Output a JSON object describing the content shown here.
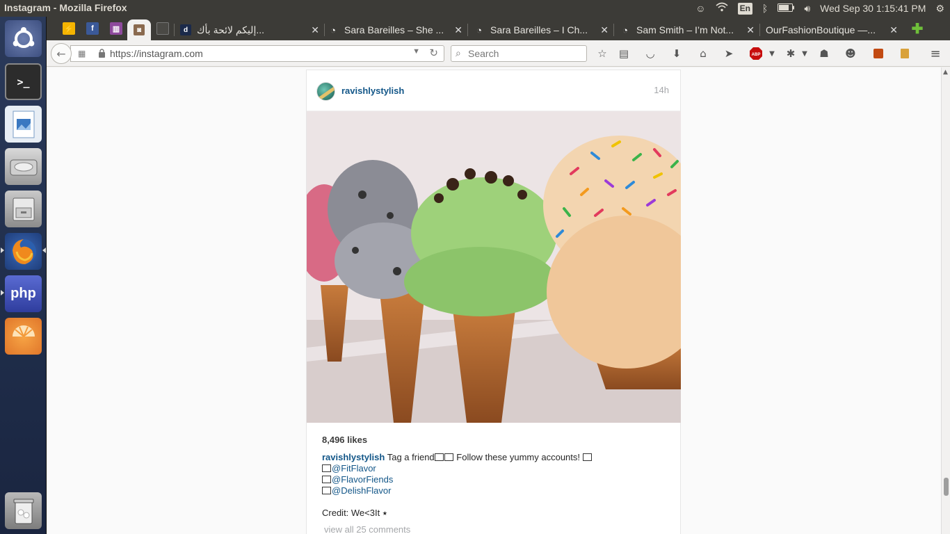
{
  "system": {
    "window_title": "Instagram - Mozilla Firefox",
    "language": "En",
    "clock": "Wed Sep 30  1:15:41 PM"
  },
  "tabs": [
    {
      "title": "إليكم لائحة بأك...",
      "favicon": "d"
    },
    {
      "title": "Sara Bareilles – She ..."
    },
    {
      "title": "Sara Bareilles – I Ch..."
    },
    {
      "title": "Sam Smith – I’m Not..."
    },
    {
      "title": "OurFashionBoutique —..."
    }
  ],
  "navbar": {
    "url": "https://instagram.com",
    "search_placeholder": "Search",
    "adblock_label": "ABP"
  },
  "launcher": {
    "php_label": "php"
  },
  "post": {
    "username": "ravishlystylish",
    "time": "14h",
    "likes": "8,496 likes",
    "caption_user": "ravishlystylish",
    "caption_text_1": "Tag a friend",
    "caption_text_2": "Follow these yummy accounts!",
    "mentions": [
      "@FitFlavor",
      "@FlavorFiends",
      "@DelishFlavor"
    ],
    "credit": "Credit: We<3It ⭑",
    "view_all": "view all 25 comments"
  },
  "colors": {
    "link_blue": "#125688",
    "panel": "#3c3b37"
  }
}
